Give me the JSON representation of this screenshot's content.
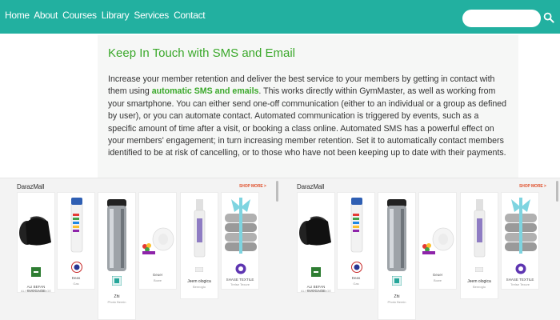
{
  "nav": {
    "items": [
      "Home",
      "About",
      "Courses",
      "Library",
      "Services",
      "Contact"
    ]
  },
  "search": {
    "placeholder": "",
    "icon": "search-icon"
  },
  "main": {
    "heading": "Keep In Touch with SMS and Email",
    "para_before": "Increase your member retention and deliver the best service to your members by getting in contact with them using ",
    "link": "automatic SMS and emails",
    "para_after": ". This works directly within GymMaster, as well as working from your smartphone. You can either send one-off communication (either to an individual or a group as defined by user), or you can automate contact. Automated communication is triggered by events, such as a specific amount of time after a visit, or booking a class online. Automated SMS has a powerful effect on your members' engagement; in turn increasing member retention. Set it to automatically contact members identified to be at risk of cancelling, or to those who have not been keeping up to date with their payments."
  },
  "ads": [
    {
      "brand": "DarazMall",
      "shop_all": "SHOP MORE >",
      "products": [
        {
          "name": "ALI BEFAN SUGGAGE",
          "sub": "ALI SPRINGIGNAGE"
        },
        {
          "name": "Deas",
          "sub": "Gas"
        },
        {
          "name": "Zhi",
          "sub": "Photo Bemin"
        },
        {
          "name": "Geuer",
          "sub": "Bowe"
        },
        {
          "name": "Jeem ologica",
          "sub": "Benroglo"
        },
        {
          "name": "SHASE TEXTILE",
          "sub": "Trelse Texure"
        }
      ]
    },
    {
      "brand": "DarazMall",
      "shop_all": "SHOP MORE >",
      "products": [
        {
          "name": "ALI BEFAN SUGGAGE",
          "sub": "ALI SPRINGIGNAGE"
        },
        {
          "name": "Deas",
          "sub": "Gas"
        },
        {
          "name": "Zhi",
          "sub": "Photo Bemin"
        },
        {
          "name": "Geuer",
          "sub": "Bowe"
        },
        {
          "name": "Jeem ologica",
          "sub": "Benroglo"
        },
        {
          "name": "SHASE TEXTILE",
          "sub": "Trelse Texure"
        }
      ]
    }
  ],
  "colors": {
    "topbar": "#22b0a0",
    "heading": "#3aa82a",
    "link": "#3aa82a",
    "shop_all": "#e0522e"
  }
}
